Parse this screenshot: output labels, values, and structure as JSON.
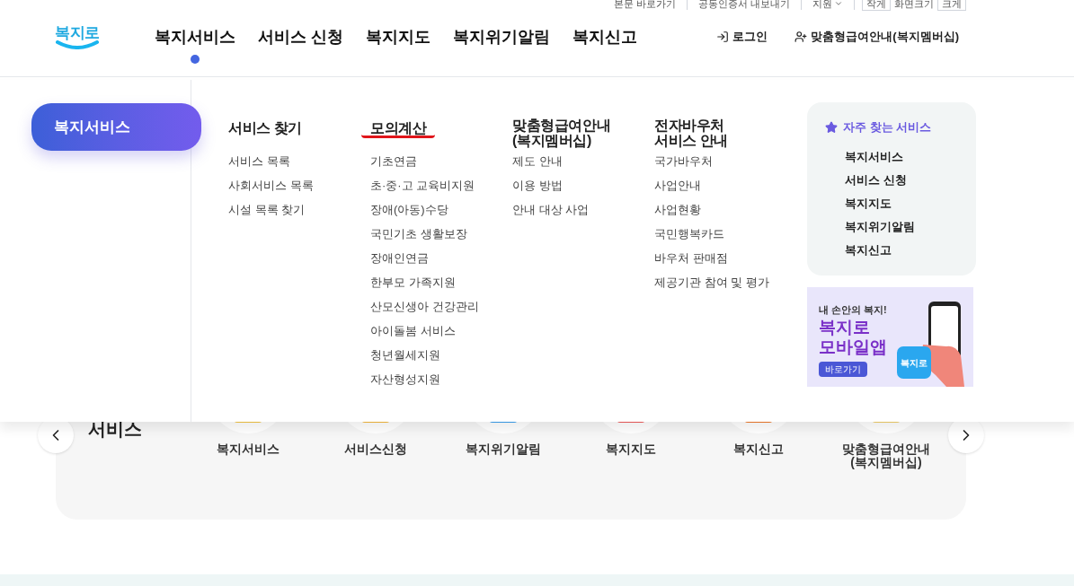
{
  "utility_links": [
    {
      "label": "본문 바로가기",
      "kind": "link"
    },
    {
      "label": "공동인증서 내보내기",
      "kind": "link"
    },
    {
      "label": "지원",
      "kind": "dropdown"
    }
  ],
  "font_size": {
    "smaller": "작게",
    "label": "화면크기",
    "larger": "크게"
  },
  "logo": {
    "text": "복지로"
  },
  "nav": [
    {
      "label": "복지서비스",
      "selected": true
    },
    {
      "label": "서비스 신청",
      "selected": false
    },
    {
      "label": "복지지도",
      "selected": false
    },
    {
      "label": "복지위기알림",
      "selected": false
    },
    {
      "label": "복지신고",
      "selected": false
    }
  ],
  "account": [
    {
      "label": "로그인",
      "kind": "login"
    },
    {
      "label": "맞춤형급여안내(복지멤버십)",
      "kind": "member"
    }
  ],
  "mega_menu": {
    "title": "복지서비스",
    "columns": [
      {
        "heading": "서비스 찾기",
        "highlighted": false,
        "items": [
          "서비스 목록",
          "사회서비스 목록",
          "시설 목록 찾기"
        ]
      },
      {
        "heading": "모의계산",
        "highlighted": true,
        "items": [
          "기초연금",
          "초·중·고 교육비지원",
          "장애(아동)수당",
          "국민기초 생활보장",
          "장애인연금",
          "한부모 가족지원",
          "산모신생아 건강관리",
          "아이돌봄 서비스",
          "청년월세지원",
          "자산형성지원"
        ]
      },
      {
        "heading": "맞춤형급여안내\n(복지멤버십)",
        "highlighted": false,
        "items": [
          "제도 안내",
          "이용 방법",
          "안내 대상 사업"
        ]
      },
      {
        "heading": "전자바우처\n서비스 안내",
        "highlighted": false,
        "items": [
          "국가바우처",
          "사업안내",
          "사업현황",
          "국민행복카드",
          "바우처 판매점",
          "제공기관 참여 및 평가"
        ]
      }
    ],
    "favorites": {
      "title": "자주 찾는 서비스",
      "items": [
        "복지서비스",
        "서비스 신청",
        "복지지도",
        "복지위기알림",
        "복지신고"
      ]
    },
    "banner": {
      "kicker": "내 손안의 복지!",
      "title": "복지로\n모바일앱",
      "button": "바로가기",
      "app_icon": "복지로"
    }
  },
  "quick_services": {
    "title": "서비스",
    "items": [
      "복지서비스",
      "서비스신청",
      "복지위기알림",
      "복지지도",
      "복지신고",
      "맞춤형급여안내\n(복지멤버십)"
    ]
  }
}
